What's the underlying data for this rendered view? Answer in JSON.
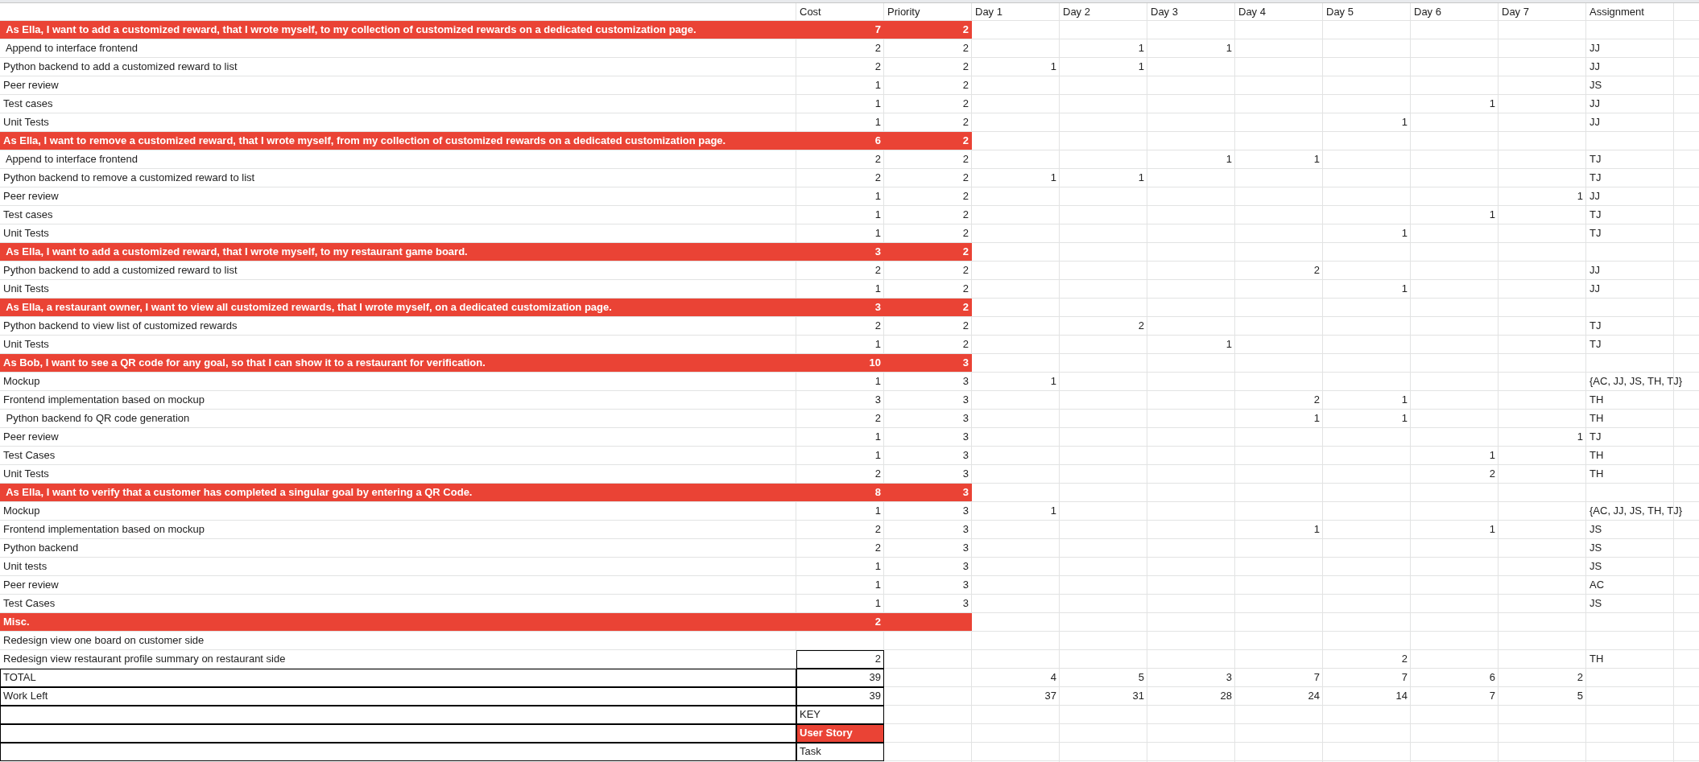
{
  "columns": [
    "Cost",
    "Priority",
    "Day 1",
    "Day 2",
    "Day 3",
    "Day 4",
    "Day 5",
    "Day 6",
    "Day 7",
    "Assignment"
  ],
  "rows": [
    {
      "kind": "story",
      "task": " As Ella, I want to add a customized reward, that I wrote myself, to my collection of customized rewards on a dedicated customization page.",
      "cost": "7",
      "priority": "2"
    },
    {
      "kind": "task",
      "task": " Append to interface frontend",
      "cost": "2",
      "priority": "2",
      "days": {
        "day_2": "1",
        "day_3": "1"
      },
      "assignment": "JJ"
    },
    {
      "kind": "task",
      "task": "Python backend to add a customized reward to list",
      "cost": "2",
      "priority": "2",
      "days": {
        "day_1": "1",
        "day_2": "1"
      },
      "assignment": "JJ"
    },
    {
      "kind": "task",
      "task": "Peer review",
      "cost": "1",
      "priority": "2",
      "assignment": "JS"
    },
    {
      "kind": "task",
      "task": "Test cases",
      "cost": "1",
      "priority": "2",
      "days": {
        "day_6": "1"
      },
      "assignment": "JJ"
    },
    {
      "kind": "task",
      "task": "Unit Tests",
      "cost": "1",
      "priority": "2",
      "days": {
        "day_5": "1"
      },
      "assignment": "JJ"
    },
    {
      "kind": "story",
      "task": "As Ella, I want to remove a customized reward, that I wrote myself, from my collection of customized rewards on a dedicated customization page.",
      "cost": "6",
      "priority": "2"
    },
    {
      "kind": "task",
      "task": " Append to interface frontend",
      "cost": "2",
      "priority": "2",
      "days": {
        "day_3": "1",
        "day_4": "1"
      },
      "assignment": "TJ"
    },
    {
      "kind": "task",
      "task": "Python backend to remove a customized reward to list",
      "cost": "2",
      "priority": "2",
      "days": {
        "day_1": "1",
        "day_2": "1"
      },
      "assignment": "TJ"
    },
    {
      "kind": "task",
      "task": "Peer review",
      "cost": "1",
      "priority": "2",
      "days": {
        "day_7": "1"
      },
      "assignment": "JJ"
    },
    {
      "kind": "task",
      "task": "Test cases",
      "cost": "1",
      "priority": "2",
      "days": {
        "day_6": "1"
      },
      "assignment": "TJ"
    },
    {
      "kind": "task",
      "task": "Unit Tests",
      "cost": "1",
      "priority": "2",
      "days": {
        "day_5": "1"
      },
      "assignment": "TJ"
    },
    {
      "kind": "story",
      "task": " As Ella, I want to add a customized reward, that I wrote myself, to my restaurant game board.",
      "cost": "3",
      "priority": "2"
    },
    {
      "kind": "task",
      "task": "Python backend to add a customized reward to list",
      "cost": "2",
      "priority": "2",
      "days": {
        "day_4": "2"
      },
      "assignment": "JJ"
    },
    {
      "kind": "task",
      "task": "Unit Tests",
      "cost": "1",
      "priority": "2",
      "days": {
        "day_5": "1"
      },
      "assignment": "JJ"
    },
    {
      "kind": "story",
      "task": " As Ella, a restaurant owner, I want to view all customized rewards, that I wrote myself, on a dedicated customization page.",
      "cost": "3",
      "priority": "2"
    },
    {
      "kind": "task",
      "task": "Python backend to view list of customized rewards",
      "cost": "2",
      "priority": "2",
      "days": {
        "day_2": "2"
      },
      "assignment": "TJ"
    },
    {
      "kind": "task",
      "task": "Unit Tests",
      "cost": "1",
      "priority": "2",
      "days": {
        "day_3": "1"
      },
      "assignment": "TJ"
    },
    {
      "kind": "story",
      "task": "As Bob, I want to see a QR code for any goal, so that I can show it to a restaurant for verification.",
      "cost": "10",
      "priority": "3"
    },
    {
      "kind": "task",
      "task": "Mockup",
      "cost": "1",
      "priority": "3",
      "days": {
        "day_1": "1"
      },
      "assignment": "{AC, JJ, JS, TH, TJ}"
    },
    {
      "kind": "task",
      "task": "Frontend implementation based on mockup",
      "cost": "3",
      "priority": "3",
      "days": {
        "day_4": "2",
        "day_5": "1"
      },
      "assignment": "TH"
    },
    {
      "kind": "task",
      "task": " Python backend fo QR code generation",
      "cost": "2",
      "priority": "3",
      "days": {
        "day_4": "1",
        "day_5": "1"
      },
      "assignment": "TH"
    },
    {
      "kind": "task",
      "task": "Peer review",
      "cost": "1",
      "priority": "3",
      "days": {
        "day_7": "1"
      },
      "assignment": "TJ"
    },
    {
      "kind": "task",
      "task": "Test Cases",
      "cost": "1",
      "priority": "3",
      "days": {
        "day_6": "1"
      },
      "assignment": "TH"
    },
    {
      "kind": "task",
      "task": "Unit Tests",
      "cost": "2",
      "priority": "3",
      "days": {
        "day_6": "2"
      },
      "assignment": "TH"
    },
    {
      "kind": "story",
      "task": " As Ella, I want to verify that a customer has completed a singular goal by entering a QR Code.",
      "cost": "8",
      "priority": "3"
    },
    {
      "kind": "task",
      "task": "Mockup",
      "cost": "1",
      "priority": "3",
      "days": {
        "day_1": "1"
      },
      "assignment": "{AC, JJ, JS, TH, TJ}"
    },
    {
      "kind": "task",
      "task": "Frontend implementation based on mockup",
      "cost": "2",
      "priority": "3",
      "days": {
        "day_4": "1",
        "day_6": "1"
      },
      "assignment": "JS"
    },
    {
      "kind": "task",
      "task": "Python backend",
      "cost": "2",
      "priority": "3",
      "assignment": "JS"
    },
    {
      "kind": "task",
      "task": "Unit tests",
      "cost": "1",
      "priority": "3",
      "assignment": "JS"
    },
    {
      "kind": "task",
      "task": "Peer review",
      "cost": "1",
      "priority": "3",
      "assignment": "AC"
    },
    {
      "kind": "task",
      "task": "Test Cases",
      "cost": "1",
      "priority": "3",
      "assignment": "JS"
    },
    {
      "kind": "story",
      "task": "Misc.",
      "cost": "2"
    },
    {
      "kind": "task",
      "task": "Redesign view one board on customer side"
    },
    {
      "kind": "boxed_task",
      "task": "Redesign view restaurant profile summary on restaurant side",
      "cost": "2",
      "days": {
        "day_5": "2"
      },
      "assignment": "TH"
    },
    {
      "kind": "total",
      "task": "TOTAL",
      "cost": "39",
      "days": {
        "day_1": "4",
        "day_2": "5",
        "day_3": "3",
        "day_4": "7",
        "day_5": "7",
        "day_6": "6",
        "day_7": "2"
      }
    },
    {
      "kind": "total",
      "task": "Work Left",
      "cost": "39",
      "days": {
        "day_1": "37",
        "day_2": "31",
        "day_3": "28",
        "day_4": "24",
        "day_5": "14",
        "day_6": "7",
        "day_7": "5"
      }
    },
    {
      "kind": "legend_title",
      "cost": "KEY"
    },
    {
      "kind": "legend_story",
      "cost": "User Story"
    },
    {
      "kind": "legend_task",
      "cost": "Task"
    }
  ]
}
